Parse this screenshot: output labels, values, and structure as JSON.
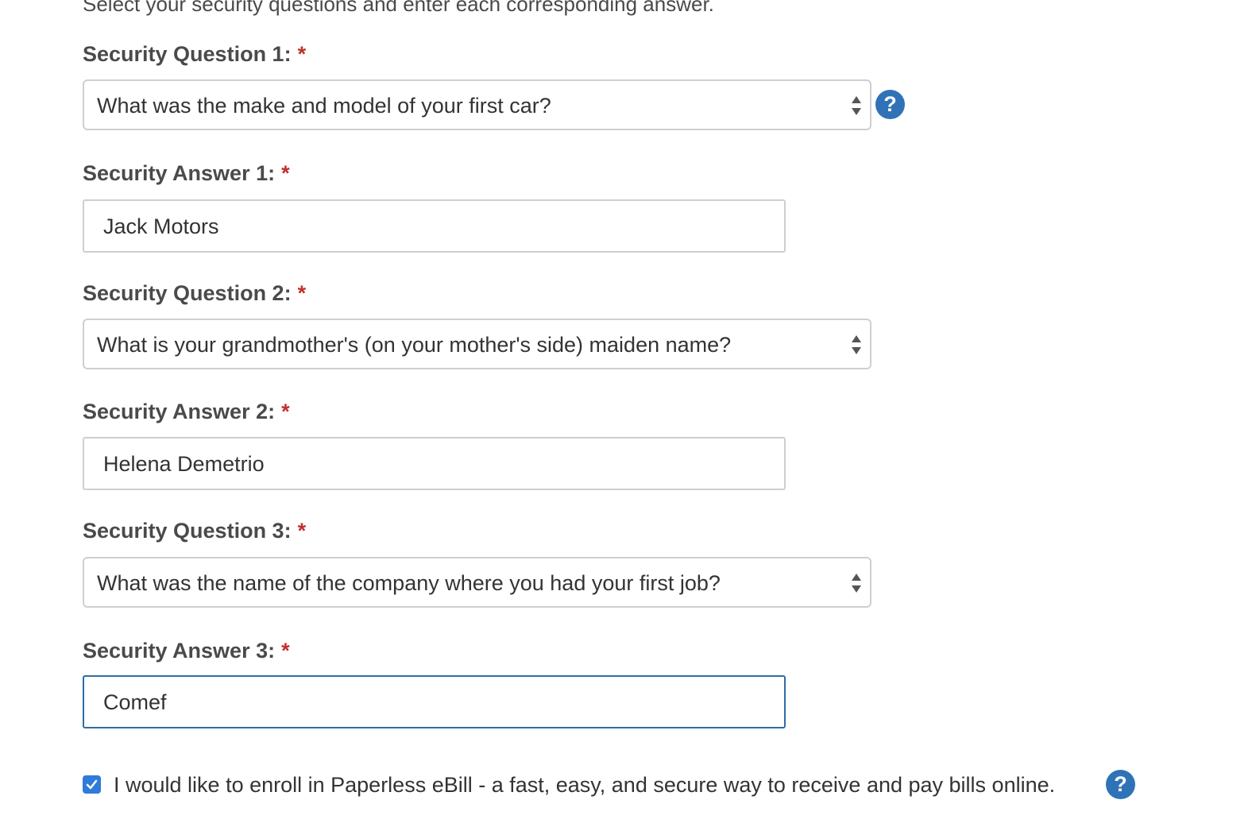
{
  "intro_text": "Select your security questions and enter each corresponding answer.",
  "required_marker": "*",
  "help_glyph": "?",
  "fields": {
    "q1": {
      "label": "Security Question 1:",
      "value": "What was the make and model of your first car?"
    },
    "a1": {
      "label": "Security Answer 1:",
      "value": "Jack Motors"
    },
    "q2": {
      "label": "Security Question 2:",
      "value": "What is your grandmother's (on your mother's side) maiden name?"
    },
    "a2": {
      "label": "Security Answer 2:",
      "value": "Helena Demetrio"
    },
    "q3": {
      "label": "Security Question 3:",
      "value": "What was the name of the company where you had your first job?"
    },
    "a3": {
      "label": "Security Answer 3:",
      "value": "Comef"
    }
  },
  "enroll": {
    "checked": true,
    "label": "I would like to enroll in Paperless eBill - a fast, easy, and secure way to receive and pay bills online."
  },
  "colors": {
    "required": "#c0302b",
    "help_icon": "#2f73b6",
    "focus_border": "#2e6da4",
    "checkbox": "#2f7bd9"
  },
  "icons": {
    "help": "question-circle-icon",
    "select_arrows": "up-down-arrows-icon",
    "check": "checkmark-icon"
  }
}
